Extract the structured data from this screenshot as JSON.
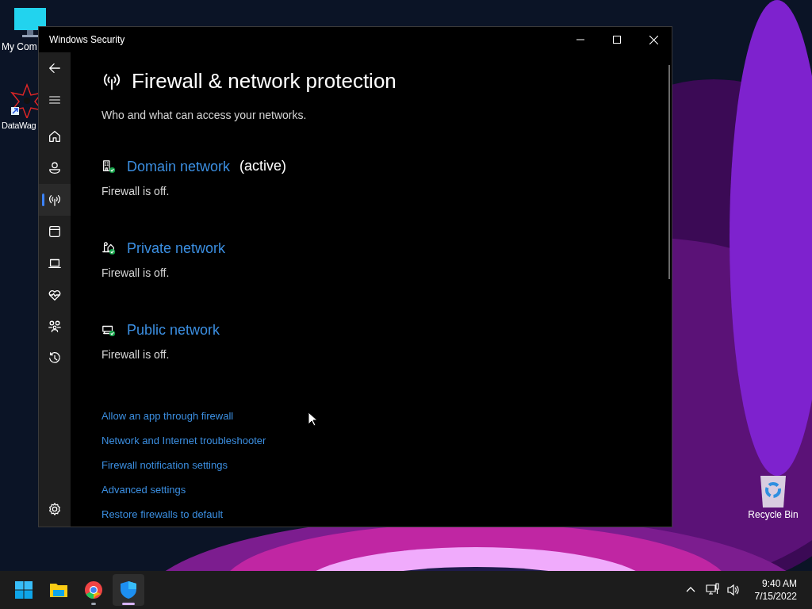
{
  "desktop_icons": [
    {
      "label": "My Com",
      "kind": "computer"
    },
    {
      "label": "DataWag",
      "kind": "app"
    },
    {
      "label": "Recycle Bin",
      "kind": "bin"
    }
  ],
  "window": {
    "title": "Windows Security"
  },
  "nav": [
    {
      "kind": "home",
      "selected": false
    },
    {
      "kind": "account",
      "selected": false
    },
    {
      "kind": "firewall",
      "selected": true
    },
    {
      "kind": "browser",
      "selected": false
    },
    {
      "kind": "device",
      "selected": false
    },
    {
      "kind": "health",
      "selected": false
    },
    {
      "kind": "family",
      "selected": false
    },
    {
      "kind": "history",
      "selected": false
    }
  ],
  "page": {
    "title": "Firewall & network protection",
    "subtitle": "Who and what can access your networks.",
    "networks": [
      {
        "kind": "domain",
        "name": "Domain network",
        "tag": "(active)",
        "status": "Firewall is off."
      },
      {
        "kind": "private",
        "name": "Private network",
        "status": "Firewall is off."
      },
      {
        "kind": "public",
        "name": "Public network",
        "status": "Firewall is off."
      }
    ],
    "links": [
      "Allow an app through firewall",
      "Network and Internet troubleshooter",
      "Firewall notification settings",
      "Advanced settings",
      "Restore firewalls to default"
    ]
  },
  "taskbar": {
    "apps": [
      {
        "kind": "start",
        "running": false,
        "selected": false
      },
      {
        "kind": "explorer",
        "running": false,
        "selected": false
      },
      {
        "kind": "chrome",
        "running": true,
        "selected": false
      },
      {
        "kind": "security",
        "running": true,
        "selected": true
      }
    ],
    "time": "9:40 AM",
    "date": "7/15/2022"
  }
}
